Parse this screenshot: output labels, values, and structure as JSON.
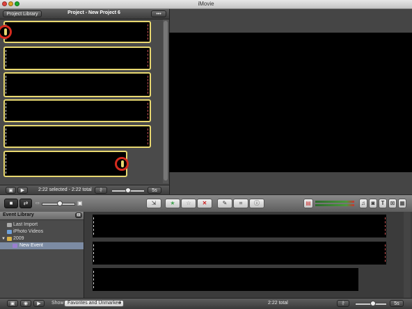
{
  "window": {
    "title": "iMovie"
  },
  "project": {
    "library_button": "Project Library",
    "title": "Project - New Project 6",
    "status": "2:22 selected - 2:22 total",
    "zoom_value": "5s"
  },
  "toolbar": {
    "icons": [
      "camera-icon",
      "swap-icon",
      "thumbnail-size-slider",
      "add-to-project-icon",
      "favorite-star-icon",
      "unmark-star-icon",
      "reject-x-icon",
      "voiceover-mic-icon",
      "crop-icon",
      "info-icon",
      "audio-level-meter",
      "music-icon",
      "photo-icon",
      "title-icon",
      "transition-icon",
      "map-icon"
    ]
  },
  "event_library": {
    "header": "Event Library",
    "items": [
      {
        "label": "Last Import",
        "icon": "clips-icon"
      },
      {
        "label": "iPhoto Videos",
        "icon": "iphoto-icon"
      },
      {
        "label": "2009",
        "icon": "folder-icon"
      },
      {
        "label": "New Event",
        "icon": "event-star-icon",
        "selected": true
      }
    ]
  },
  "bottom": {
    "show_label": "Show",
    "show_value": "Favorites and Unmarked",
    "total": "2:22 total",
    "zoom_value": "5s"
  },
  "colors": {
    "clip_border": "#e8d870",
    "playhead_ring": "#d52b1e",
    "selection": "#7c8ba3",
    "star_green": "#3fa34d",
    "reject_red": "#cc2222"
  }
}
